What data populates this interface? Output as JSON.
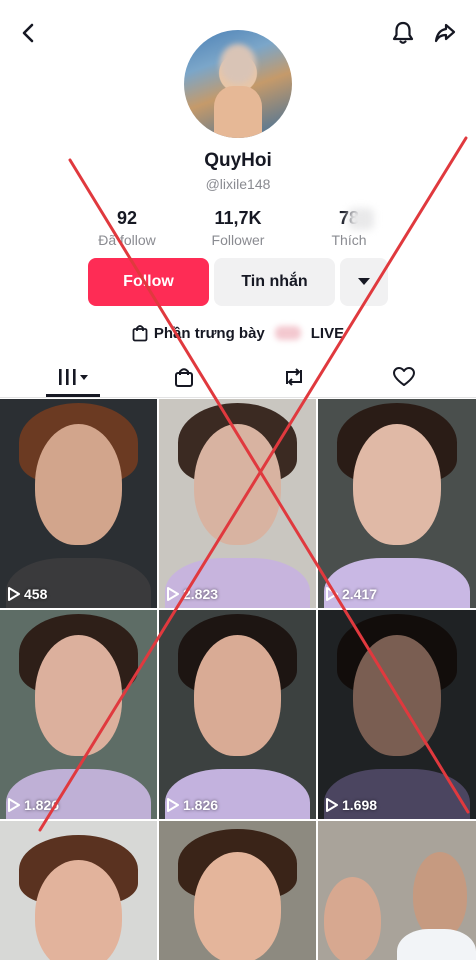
{
  "profile": {
    "display_name": "QuyHoi",
    "handle": "@lixile148"
  },
  "stats": [
    {
      "value": "92",
      "label": "Đã follow"
    },
    {
      "value": "11,7K",
      "label": "Follower"
    },
    {
      "value": "78",
      "label": "Thích"
    }
  ],
  "actions": {
    "follow_label": "Follow",
    "message_label": "Tin nhắn"
  },
  "showcase": {
    "label": "Phần trưng bày",
    "live_label": "LIVE"
  },
  "videos": [
    {
      "views": "458"
    },
    {
      "views": "2.823"
    },
    {
      "views": "2.417"
    },
    {
      "views": "1.826"
    },
    {
      "views": "1.826"
    },
    {
      "views": "1.698"
    },
    {
      "views": ""
    },
    {
      "views": ""
    },
    {
      "views": ""
    }
  ],
  "colors": {
    "accent": "#fe2c55",
    "overlay_cross": "#e0393e",
    "text_primary": "#161823",
    "text_secondary": "#8a8b91"
  },
  "icons": {
    "back": "chevron-left-icon",
    "bell": "bell-icon",
    "share": "share-icon",
    "more": "caret-down-icon",
    "bag": "shopping-bag-icon",
    "grid": "grid-icon",
    "repost": "repost-icon",
    "liked": "heart-icon",
    "play": "play-icon"
  }
}
